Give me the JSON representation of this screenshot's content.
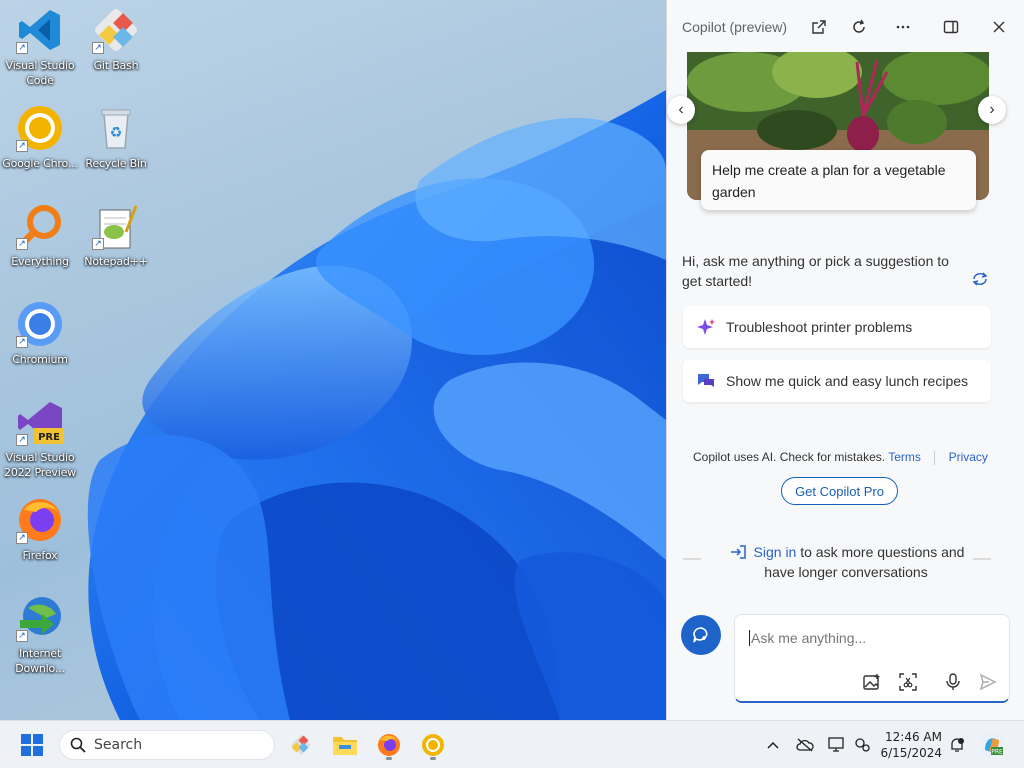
{
  "desktop": {
    "icons": [
      {
        "label": "Visual Studio Code",
        "icon": "vscode-icon"
      },
      {
        "label": "Git Bash",
        "icon": "git-bash-icon"
      },
      {
        "label": "Google Chro...",
        "icon": "google-chrome-icon"
      },
      {
        "label": "Recycle Bin",
        "icon": "recycle-bin-icon"
      },
      {
        "label": "Everything",
        "icon": "everything-search-icon"
      },
      {
        "label": "Notepad++",
        "icon": "notepad-plus-plus-icon"
      },
      {
        "label": "Chromium",
        "icon": "chromium-icon"
      },
      {
        "label": "Visual Studio 2022 Preview",
        "icon": "visual-studio-preview-icon",
        "badge": "PRE"
      },
      {
        "label": "Firefox",
        "icon": "firefox-icon"
      },
      {
        "label": "Internet Downlo...",
        "icon": "internet-download-manager-icon"
      }
    ]
  },
  "copilot": {
    "title": "Copilot (preview)",
    "hero_prompt": "Help me create a plan for a vegetable garden",
    "greeting": "Hi, ask me anything or pick a suggestion to get started!",
    "suggestions": [
      {
        "label": "Troubleshoot printer problems",
        "icon": "sparkle-icon"
      },
      {
        "label": "Show me quick and easy lunch recipes",
        "icon": "chat-bubbles-icon"
      }
    ],
    "disclaimer": "Copilot uses AI. Check for mistakes.",
    "terms_link": "Terms",
    "privacy_link": "Privacy",
    "pro_button": "Get Copilot Pro",
    "signin_link": "Sign in",
    "signin_text_1": "to ask more questions and",
    "signin_text_2": "have longer conversations",
    "input_placeholder": "Ask me anything..."
  },
  "taskbar": {
    "search_placeholder": "Search",
    "time": "12:46 AM",
    "date": "6/15/2024"
  },
  "colors": {
    "accent": "#1d63c9",
    "link": "#2a62c9",
    "wallpaper_blue": "#1f6fe8"
  }
}
